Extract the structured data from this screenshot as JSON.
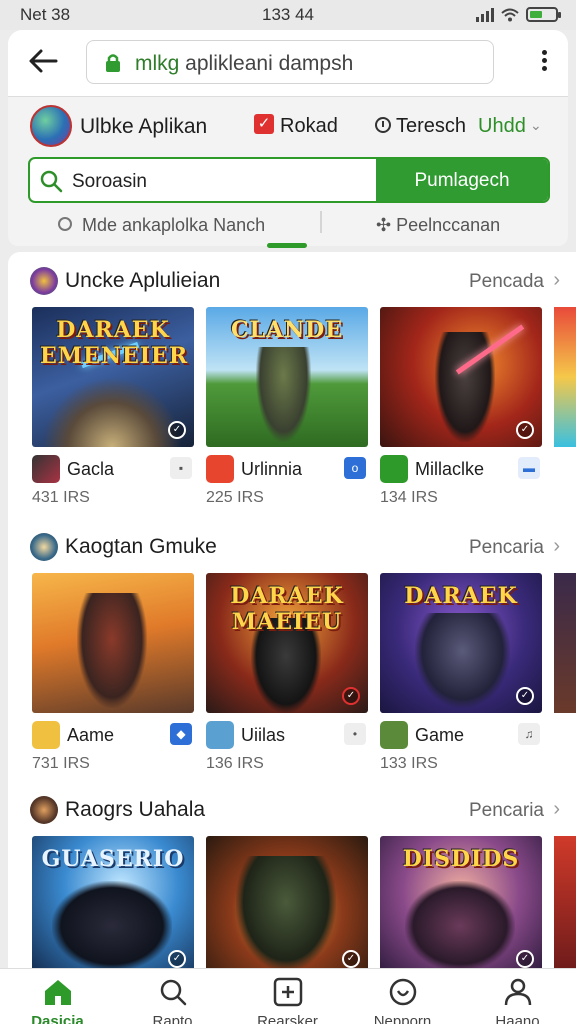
{
  "status_bar": {
    "carrier": "Net 38",
    "time": "133 44"
  },
  "browser": {
    "url_highlight": "mlkg",
    "url_rest": " aplikleani dampsh"
  },
  "header": {
    "app_title": "Ulbke Aplikan",
    "checkbox_label": "Rokad",
    "refresh_label": "Teresch",
    "update_label": "Uhdd"
  },
  "search": {
    "value": "Soroasin",
    "button_label": "Pumlagech",
    "hint_left": "Mde ankaplolka Nanch",
    "hint_right": "Peelnccanan"
  },
  "sections": [
    {
      "title": "Uncke Aplulieian",
      "more_label": "Pencada",
      "cards": [
        {
          "name": "Gacla",
          "size": "431 IRS",
          "art_title": "DARAEK EMENEIER"
        },
        {
          "name": "Urlinnia",
          "size": "225 IRS",
          "art_title": "CLANDE"
        },
        {
          "name": "Millaclke",
          "size": "134 IRS",
          "art_title": ""
        }
      ]
    },
    {
      "title": "Kaogtan Gmuke",
      "more_label": "Pencaria",
      "cards": [
        {
          "name": "Aame",
          "size": "731 IRS",
          "art_title": ""
        },
        {
          "name": "Uiilas",
          "size": "136 IRS",
          "art_title": "DARAEK MAEIEU"
        },
        {
          "name": "Game",
          "size": "133 IRS",
          "art_title": "DARAEK"
        }
      ]
    },
    {
      "title": "Raogrs Uahala",
      "more_label": "Pencaria",
      "cards": [
        {
          "name": "",
          "size": "",
          "art_title": "GUASERIO"
        },
        {
          "name": "",
          "size": "",
          "art_title": ""
        },
        {
          "name": "",
          "size": "",
          "art_title": "DISDIDS"
        }
      ]
    }
  ],
  "bottom_nav": [
    {
      "label": "Dasicia",
      "icon": "home-icon",
      "active": true
    },
    {
      "label": "Rapto",
      "icon": "search-icon"
    },
    {
      "label": "Rearsker",
      "icon": "apps-icon"
    },
    {
      "label": "Nepporn",
      "icon": "updates-icon"
    },
    {
      "label": "Haano",
      "icon": "profile-icon"
    }
  ],
  "colors": {
    "accent": "#2e9a2a",
    "checkbox": "#e03131"
  }
}
